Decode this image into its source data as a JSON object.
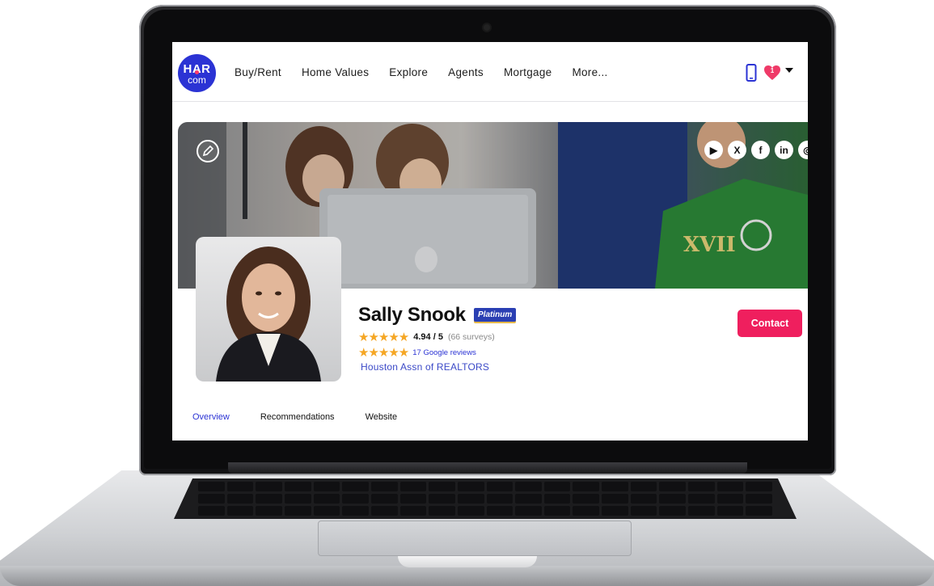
{
  "nav": {
    "logo_top": "HAR",
    "logo_bottom": "com",
    "items": [
      "Buy/Rent",
      "Home Values",
      "Explore",
      "Agents",
      "Mortgage",
      "More..."
    ],
    "favorites_count": "1"
  },
  "profile": {
    "name": "Sally Snook",
    "badge": "Platinum",
    "survey_stars": "★★★★★",
    "rating_value": "4.94 / 5",
    "rating_surveys": "(66 surveys)",
    "google_stars": "★★★★★",
    "google_reviews": "17 Google reviews",
    "association": "Houston Assn of REALTORS",
    "contact_label": "Contact",
    "rating_score": 4.94,
    "rating_max": 5
  },
  "social": {
    "youtube": "▶",
    "x": "X",
    "facebook": "f",
    "linkedin": "in",
    "instagram": "◎"
  },
  "tabs": [
    "Overview",
    "Recommendations",
    "Website"
  ],
  "colors": {
    "brand_blue": "#2b33d4",
    "contact_pink": "#ef1f5e",
    "star_gold": "#f5a623"
  }
}
